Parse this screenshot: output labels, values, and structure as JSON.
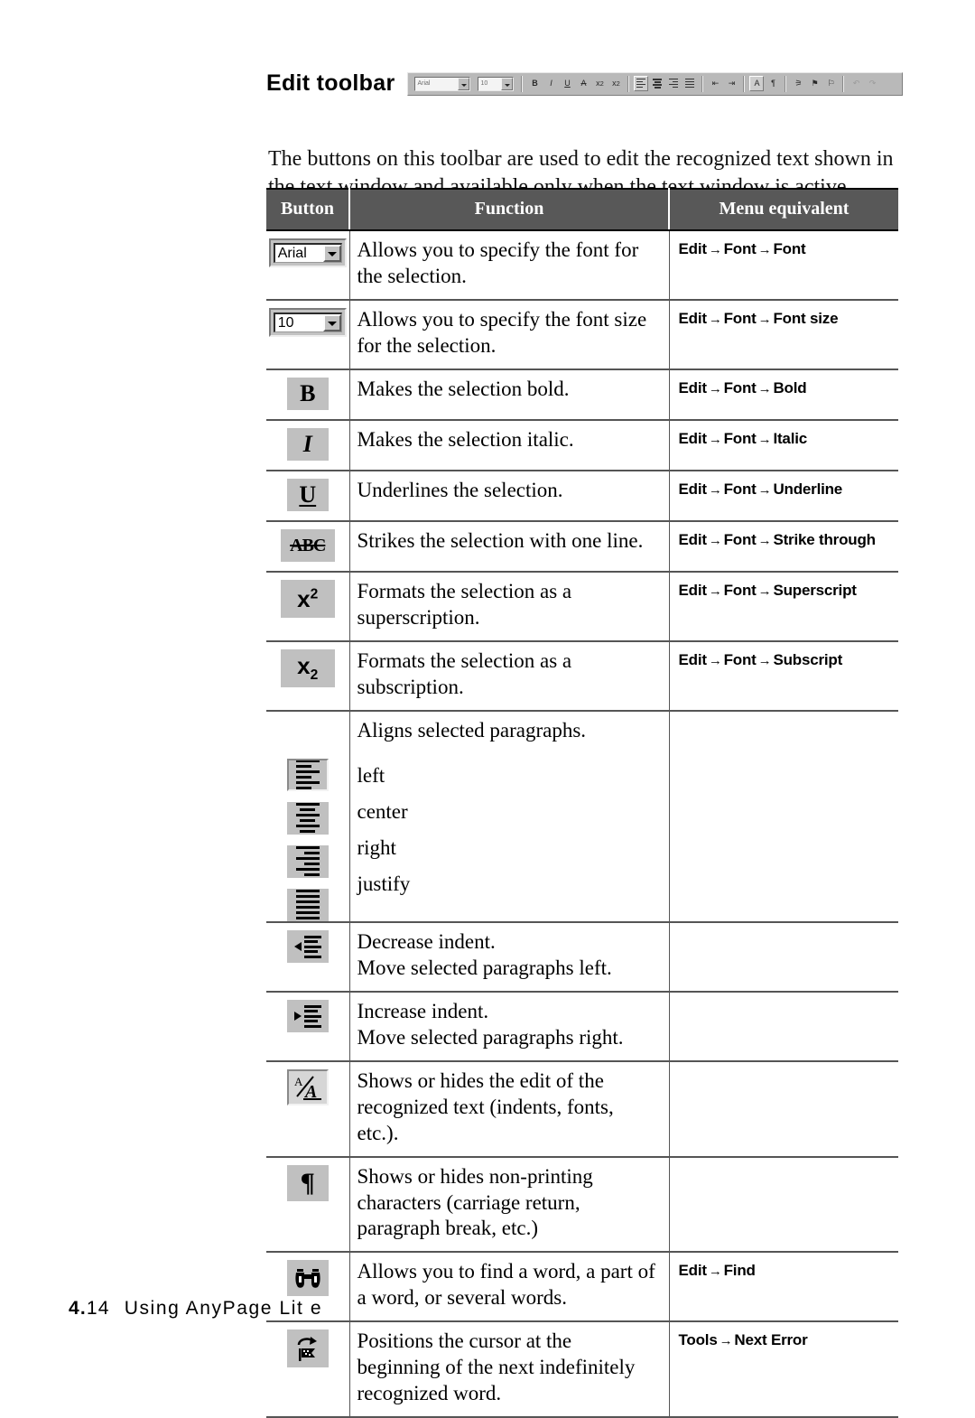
{
  "page": {
    "heading": "Edit toolbar",
    "intro": "The buttons on this toolbar are used to edit the recognized text shown in the text window and available only when the text window is active.",
    "footer": {
      "page_major": "4.",
      "page_minor": "14",
      "title": "Using AnyPage Lit e"
    }
  },
  "toolbar_strip": {
    "font_combo_value": "Arial",
    "size_combo_value": "10",
    "buttons": [
      "bold-button",
      "italic-button",
      "underline-button",
      "strikethrough-button",
      "superscript-button",
      "subscript-button",
      "align-left-button",
      "align-center-button",
      "align-right-button",
      "align-justify-button",
      "decrease-indent-button",
      "increase-indent-button",
      "toggle-format-view-button",
      "show-nonprinting-button",
      "find-button",
      "next-error-button",
      "prev-error-button",
      "undo-button",
      "redo-button"
    ]
  },
  "table": {
    "headers": [
      "Button",
      "Function",
      "Menu equivalent"
    ],
    "rows": [
      {
        "icon": "font-name-combo",
        "function": "Allows you to specify the font for the selection.",
        "menu": [
          "Edit",
          "Font",
          "Font"
        ]
      },
      {
        "icon": "font-size-combo",
        "function": "Allows you to specify the font size for the selection.",
        "menu": [
          "Edit",
          "Font",
          "Font size"
        ]
      },
      {
        "icon": "bold-button",
        "function": "Makes the selection bold.",
        "menu": [
          "Edit",
          "Font",
          "Bold"
        ]
      },
      {
        "icon": "italic-button",
        "function": "Makes the selection italic.",
        "menu": [
          "Edit",
          "Font",
          "Italic"
        ]
      },
      {
        "icon": "underline-button",
        "function": "Underlines the selection.",
        "menu": [
          "Edit",
          "Font",
          "Underline"
        ]
      },
      {
        "icon": "strikethrough-button",
        "function": "Strikes the selection with one line.",
        "menu": [
          "Edit",
          "Font",
          "Strike through"
        ]
      },
      {
        "icon": "superscript-button",
        "function": "Formats the selection as a superscription.",
        "menu": [
          "Edit",
          "Font",
          "Superscript"
        ]
      },
      {
        "icon": "subscript-button",
        "function": "Formats the selection as a subscription.",
        "menu": [
          "Edit",
          "Font",
          "Subscript"
        ]
      }
    ],
    "align_row": {
      "lead": "Aligns selected paragraphs.",
      "options": [
        "left",
        "center",
        "right",
        "justify"
      ],
      "menu": ""
    },
    "tail_rows": [
      {
        "icon": "decrease-indent-button",
        "function_lines": [
          "Decrease indent.",
          "Move selected paragraphs left."
        ],
        "menu": []
      },
      {
        "icon": "increase-indent-button",
        "function_lines": [
          "Increase indent.",
          "Move selected paragraphs right."
        ],
        "menu": []
      },
      {
        "icon": "toggle-format-view-button",
        "function_lines": [
          "Shows or hides the edit of the",
          "recognized text (indents, fonts, etc.)."
        ],
        "menu": []
      },
      {
        "icon": "show-nonprinting-button",
        "function_lines": [
          "Shows or hides non-printing",
          "characters (carriage return,",
          "paragraph break, etc.)"
        ],
        "menu": []
      },
      {
        "icon": "find-button",
        "function_lines": [
          "Allows you to find a word, a part of",
          "a word, or several words."
        ],
        "menu": [
          "Edit",
          "Find"
        ]
      },
      {
        "icon": "next-error-button",
        "function_lines": [
          "Positions the cursor at the",
          "beginning of the next indefinitely",
          "recognized word."
        ],
        "menu": [
          "Tools",
          "Next Error"
        ]
      }
    ]
  },
  "colors": {
    "header_bg": "#585858",
    "button_face": "#c0c0c0",
    "rule": "#555555"
  }
}
